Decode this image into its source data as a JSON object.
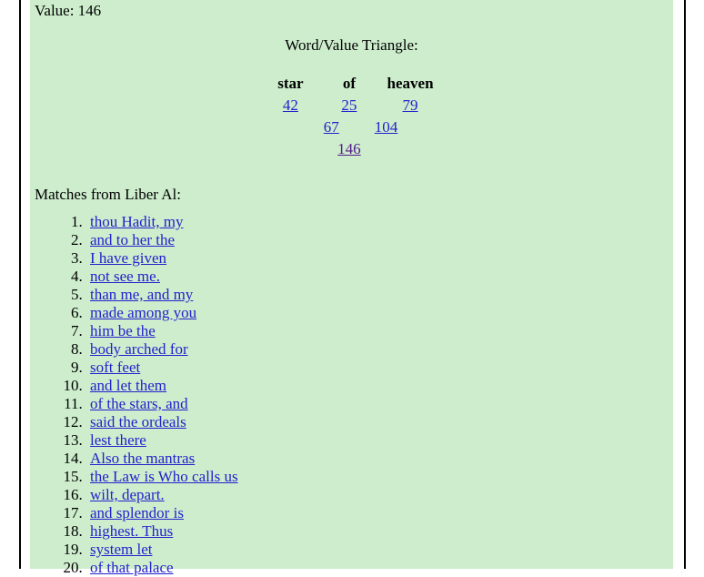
{
  "document": {
    "value_line": "Value: 146",
    "background_color": "#cdedcd",
    "link_color": "#2222cc",
    "visited_link_color": "#551a8b"
  },
  "triangle": {
    "heading": "Word/Value Triangle:",
    "words": [
      "star",
      "of",
      "heaven"
    ],
    "row1": [
      "42",
      "25",
      "79"
    ],
    "row2": [
      "67",
      "104"
    ],
    "row3": [
      "146"
    ]
  },
  "matches": {
    "heading": "Matches from Liber Al:",
    "items": [
      "thou Hadit, my",
      "and to her the",
      "I have given",
      "not see me.",
      "than me, and my",
      "made among you",
      "him be the",
      "body arched for",
      "soft feet",
      "and let them",
      "of the stars, and",
      "said the ordeals",
      "lest there",
      "Also the mantras",
      "the Law is Who calls us",
      "wilt, depart.",
      "and splendor is",
      "highest. Thus",
      "system let",
      "of that palace"
    ]
  }
}
